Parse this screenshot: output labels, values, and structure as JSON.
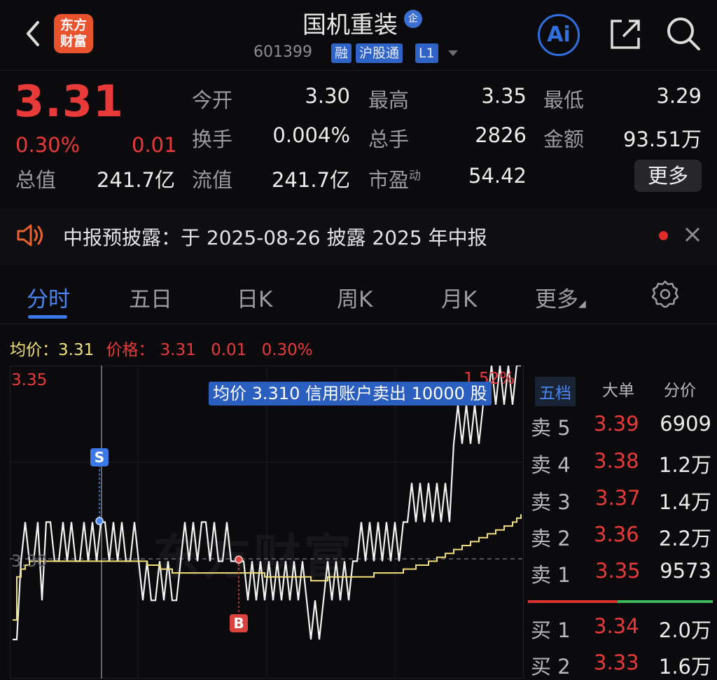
{
  "header": {
    "title": "国机重装",
    "title_badge": "企",
    "logo_line1": "东方",
    "logo_line2": "财富",
    "code": "601399",
    "tags": [
      "融",
      "沪股通",
      "L1"
    ],
    "ai_label": "Ai"
  },
  "quote": {
    "price": "3.31",
    "change_pct": "0.30%",
    "change_amt": "0.01",
    "fields": {
      "open_label": "今开",
      "open": "3.30",
      "high_label": "最高",
      "high": "3.35",
      "low_label": "最低",
      "low": "3.29",
      "turnover_label": "换手",
      "turnover": "0.004%",
      "volume_label": "总手",
      "volume": "2826",
      "amount_label": "金额",
      "amount": "93.51万",
      "mktcap_label": "总值",
      "mktcap": "241.7亿",
      "float_label": "流值",
      "float": "241.7亿",
      "pe_label": "市盈",
      "pe_sup": "动",
      "pe": "54.42"
    },
    "more_label": "更多"
  },
  "notice": {
    "text": "中报预披露：于 2025-08-26 披露 2025 年中报"
  },
  "tabs": [
    "分时",
    "五日",
    "日K",
    "周K",
    "月K",
    "更多"
  ],
  "info_row": {
    "avg_label": "均价：",
    "avg": "3.31",
    "price_label": "价格：",
    "price": "3.31",
    "chg": "0.01",
    "pct": "0.30%"
  },
  "chart": {
    "y_high_label": "3.35",
    "y_base_label": "3.30",
    "pct_label": "1.52%",
    "tooltip": "均价 3.310 信用账户卖出 10000 股",
    "watermark": "东方财富",
    "marker_sell": "S",
    "marker_buy": "B"
  },
  "chart_data": {
    "type": "line",
    "y_range": [
      3.28,
      3.36
    ],
    "base_price": 3.3,
    "series": [
      {
        "values": [
          3.29,
          3.29,
          3.31,
          3.32,
          3.31,
          3.31,
          3.32,
          3.3,
          3.32,
          3.32,
          3.31,
          3.31,
          3.32,
          3.31,
          3.32,
          3.31,
          3.31,
          3.32,
          3.31,
          3.32,
          3.31,
          3.32,
          3.32,
          3.31,
          3.32,
          3.31,
          3.32,
          3.31,
          3.31,
          3.32,
          3.31,
          3.3,
          3.31,
          3.3,
          3.3,
          3.31,
          3.3,
          3.31,
          3.3,
          3.3,
          3.31,
          3.32,
          3.31,
          3.32,
          3.31,
          3.32,
          3.32,
          3.31,
          3.32,
          3.31,
          3.31,
          3.32,
          3.31,
          3.31,
          3.31,
          3.31,
          3.3,
          3.31,
          3.3,
          3.31,
          3.3,
          3.31,
          3.3,
          3.31,
          3.3,
          3.31,
          3.3,
          3.31,
          3.3,
          3.31,
          3.3,
          3.29,
          3.3,
          3.29,
          3.3,
          3.31,
          3.3,
          3.31,
          3.3,
          3.31,
          3.3,
          3.31,
          3.31,
          3.32,
          3.31,
          3.32,
          3.31,
          3.32,
          3.31,
          3.32,
          3.31,
          3.32,
          3.31,
          3.32,
          3.32,
          3.33,
          3.32,
          3.33,
          3.32,
          3.33,
          3.32,
          3.33,
          3.32,
          3.33,
          3.32,
          3.34,
          3.35,
          3.34,
          3.35,
          3.34,
          3.35,
          3.34,
          3.35,
          3.35,
          3.36,
          3.35,
          3.36,
          3.35,
          3.36,
          3.35,
          3.36,
          3.36
        ]
      },
      {
        "values": [
          3.295,
          3.306,
          3.308,
          3.309,
          3.31,
          3.31,
          3.31,
          3.31,
          3.31,
          3.31,
          3.31,
          3.31,
          3.31,
          3.31,
          3.31,
          3.31,
          3.31,
          3.31,
          3.31,
          3.31,
          3.31,
          3.31,
          3.31,
          3.31,
          3.31,
          3.31,
          3.31,
          3.31,
          3.31,
          3.31,
          3.31,
          3.31,
          3.309,
          3.309,
          3.309,
          3.308,
          3.308,
          3.308,
          3.307,
          3.307,
          3.307,
          3.307,
          3.307,
          3.307,
          3.307,
          3.307,
          3.307,
          3.307,
          3.307,
          3.307,
          3.307,
          3.307,
          3.307,
          3.307,
          3.307,
          3.307,
          3.307,
          3.307,
          3.307,
          3.307,
          3.306,
          3.306,
          3.306,
          3.306,
          3.306,
          3.306,
          3.306,
          3.306,
          3.306,
          3.306,
          3.306,
          3.305,
          3.305,
          3.305,
          3.305,
          3.306,
          3.306,
          3.306,
          3.306,
          3.306,
          3.306,
          3.306,
          3.306,
          3.306,
          3.306,
          3.306,
          3.307,
          3.307,
          3.307,
          3.307,
          3.307,
          3.307,
          3.307,
          3.308,
          3.308,
          3.308,
          3.309,
          3.309,
          3.309,
          3.31,
          3.31,
          3.311,
          3.311,
          3.312,
          3.312,
          3.313,
          3.313,
          3.314,
          3.314,
          3.315,
          3.315,
          3.316,
          3.316,
          3.317,
          3.317,
          3.318,
          3.318,
          3.319,
          3.319,
          3.32,
          3.321,
          3.322
        ]
      }
    ]
  },
  "order_book": {
    "tabs": [
      "五档",
      "大单",
      "分价"
    ],
    "asks": [
      {
        "label": "卖",
        "level": "5",
        "price": "3.39",
        "vol": "6909"
      },
      {
        "label": "卖",
        "level": "4",
        "price": "3.38",
        "vol": "1.2万"
      },
      {
        "label": "卖",
        "level": "3",
        "price": "3.37",
        "vol": "1.4万"
      },
      {
        "label": "卖",
        "level": "2",
        "price": "3.36",
        "vol": "2.2万"
      },
      {
        "label": "卖",
        "level": "1",
        "price": "3.35",
        "vol": "9573"
      }
    ],
    "bids": [
      {
        "label": "买",
        "level": "1",
        "price": "3.34",
        "vol": "2.0万"
      },
      {
        "label": "买",
        "level": "2",
        "price": "3.33",
        "vol": "1.6万"
      }
    ]
  },
  "colors": {
    "up": "#e93a3a",
    "down": "#43c25a",
    "accent": "#3b79e8",
    "avg_line": "#f2e07a"
  }
}
